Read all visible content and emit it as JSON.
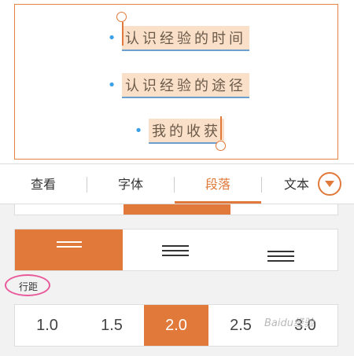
{
  "slide": {
    "bullets": [
      "认识经验的时间",
      "认识经验的途径",
      "我的收获"
    ]
  },
  "tabs": [
    {
      "label": "查看",
      "active": false
    },
    {
      "label": "字体",
      "active": false
    },
    {
      "label": "段落",
      "active": true
    },
    {
      "label": "文本",
      "active": false
    }
  ],
  "paragraph": {
    "alignment": {
      "selected": "left"
    },
    "line_spacing_label": "行距",
    "line_spacing_options": [
      "1.0",
      "1.5",
      "2.0",
      "2.5",
      "3.0"
    ],
    "line_spacing_selected": "2.0"
  },
  "watermark": "Baidu经验",
  "colors": {
    "accent": "#e0793a",
    "highlight": "#fae0c8",
    "bullet": "#3aa0e8",
    "annotation": "#e85a9a"
  }
}
